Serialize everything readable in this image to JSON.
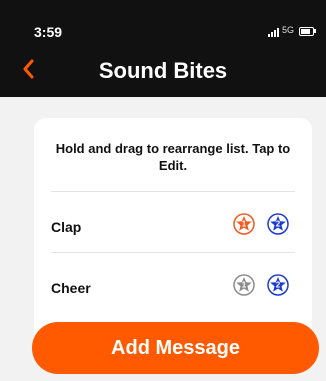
{
  "status_bar": {
    "time": "3:59",
    "network": "5G"
  },
  "header": {
    "title": "Sound Bites",
    "back_icon": "chevron-left-icon"
  },
  "card": {
    "instructions": "Hold and drag to rearrange list. Tap to Edit.",
    "items": [
      {
        "label": "Clap",
        "badges": [
          "1",
          "2"
        ],
        "badge_colors": [
          "#f25a1f",
          "#1c3bd1"
        ]
      },
      {
        "label": "Cheer",
        "badges": [
          "1",
          "2"
        ],
        "badge_colors": [
          "#8c8c8c",
          "#1c3bd1"
        ]
      }
    ]
  },
  "footer": {
    "add_message_label": "Add Message"
  },
  "colors": {
    "accent": "#ff5a00",
    "header_bg": "#111111",
    "page_bg": "#f2f2f2"
  }
}
